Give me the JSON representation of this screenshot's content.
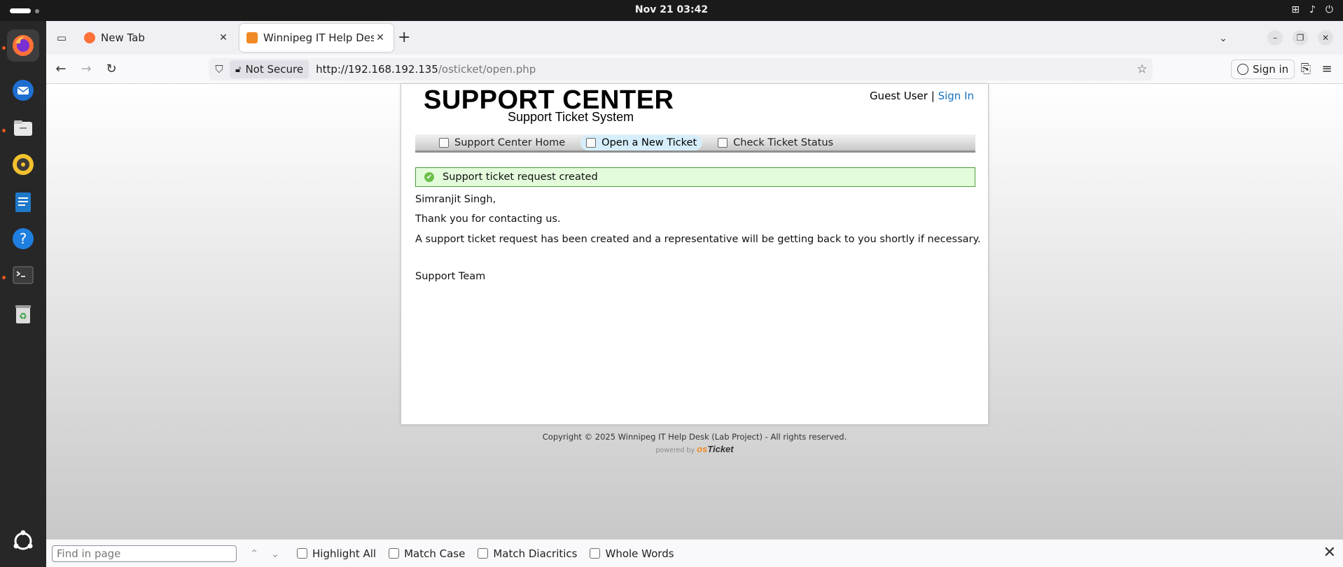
{
  "system": {
    "clock": "Nov 21  03:42"
  },
  "browser": {
    "tabs": [
      {
        "title": "New Tab"
      },
      {
        "title": "Winnipeg IT Help Desk (L"
      }
    ],
    "url_bar": {
      "security_label": "Not Secure",
      "url_host": "http://192.168.192.135",
      "url_path": "/osticket/open.php"
    },
    "sign_in_label": "Sign in"
  },
  "page": {
    "brand_title": "SUPPORT CENTER",
    "brand_subtitle": "Support Ticket System",
    "guest_label": "Guest User",
    "separator": "|",
    "sign_in_link": "Sign In",
    "nav": [
      {
        "label": "Support Center Home",
        "active": false
      },
      {
        "label": "Open a New Ticket",
        "active": true
      },
      {
        "label": "Check Ticket Status",
        "active": false
      }
    ],
    "notice": "Support ticket request created",
    "greeting": "Simranjit Singh,",
    "thanks": "Thank you for contacting us.",
    "body": "A support ticket request has been created and a representative will be getting back to you shortly if necessary.",
    "signoff": "Support Team",
    "footer": "Copyright © 2025 Winnipeg IT Help Desk (Lab Project) - All rights reserved.",
    "powered_by": "powered by",
    "logo_os": "os",
    "logo_ticket": "Ticket"
  },
  "findbar": {
    "placeholder": "Find in page",
    "options": [
      "Highlight All",
      "Match Case",
      "Match Diacritics",
      "Whole Words"
    ]
  },
  "colors": {
    "link": "#1a72c0",
    "notice_bg": "#e3fbdb",
    "notice_border": "#4f9b3a",
    "nav_active": "#d6eefb"
  }
}
